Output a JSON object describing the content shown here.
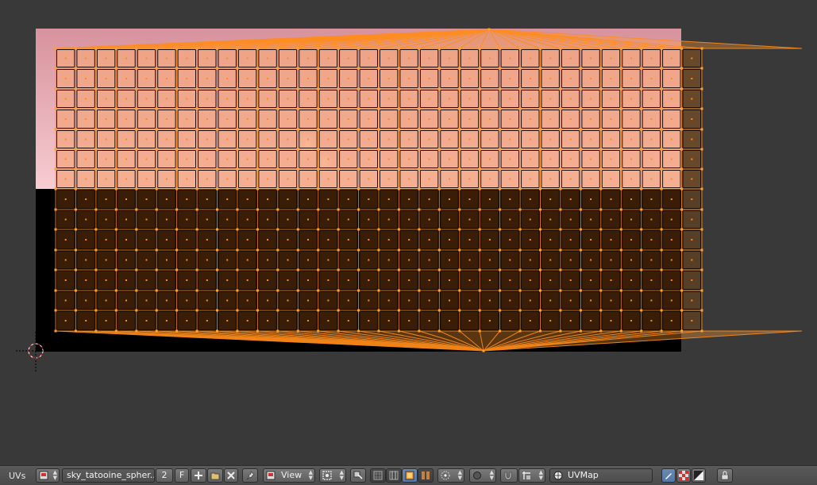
{
  "editor": {
    "header_label": "UVs",
    "image_name": "sky_tatooine_spher...",
    "users_count": "2",
    "fake_user": "F",
    "view_menu": "View",
    "uv_map_name": "UVMap"
  },
  "icons": {
    "editor_type": "image-editor-icon",
    "new_image": "plus-icon",
    "open_image": "folder-icon",
    "unlink_image": "x-icon",
    "pin": "pin-icon",
    "view_mode": "image-icon",
    "pivot": "pivot-icon",
    "sync": "uv-sync-icon",
    "select_vertex": "vertex-select-icon",
    "select_edge": "edge-select-icon",
    "select_face": "face-select-icon",
    "select_island": "island-select-icon",
    "sticky_mode": "sticky-icon",
    "proportional": "proportional-icon",
    "snap_magnet": "magnet-icon",
    "snap_target": "snap-target-icon",
    "uv_map": "uv-map-icon",
    "paint": "paint-icon",
    "checker": "checker-icon",
    "channels": "alpha-icon",
    "lock": "lock-icon"
  },
  "colors": {
    "background": "#393939",
    "selection_orange": "#ff8c1a",
    "sky_pink": "#d89ba4",
    "sand_dark": "#3a1e08"
  }
}
